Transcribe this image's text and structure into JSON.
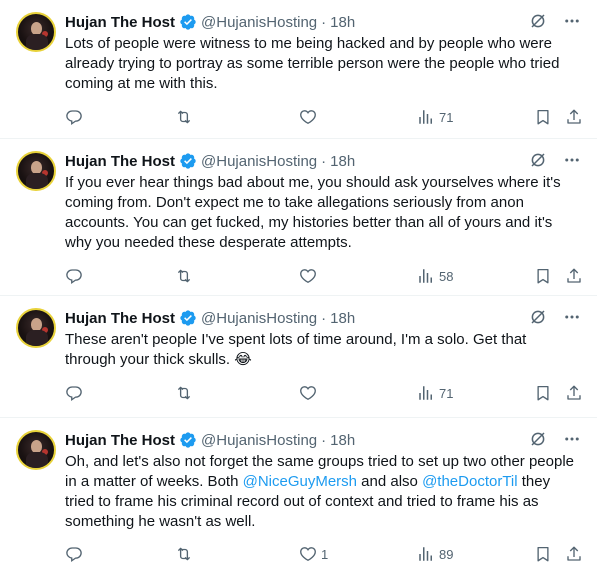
{
  "tweets": [
    {
      "name": "Hujan The Host",
      "handle": "@HujanisHosting",
      "sep": "·",
      "time": "18h",
      "text": "Lots of people were witness to me being hacked and by people who were already trying to portray as some terrible person were the people who tried coming at me with this.",
      "likes": "",
      "views": "71"
    },
    {
      "name": "Hujan The Host",
      "handle": "@HujanisHosting",
      "sep": "·",
      "time": "18h",
      "text": "If you ever hear things bad about me, you should ask yourselves where it's coming from. Don't expect me to take allegations seriously from anon accounts. You can get fucked, my histories better than all of yours and it's why you needed these desperate attempts.",
      "likes": "",
      "views": "58"
    },
    {
      "name": "Hujan The Host",
      "handle": "@HujanisHosting",
      "sep": "·",
      "time": "18h",
      "text": "These aren't people I've spent lots of time around, I'm a solo. Get that through your thick skulls. 😂",
      "likes": "",
      "views": "71"
    },
    {
      "name": "Hujan The Host",
      "handle": "@HujanisHosting",
      "sep": "·",
      "time": "18h",
      "text_a": "Oh, and let's also not forget the same groups tried to set up two other people in a matter of weeks. Both ",
      "mention1": "@NiceGuyMersh",
      "text_b": " and also ",
      "mention2": "@theDoctorTil",
      "text_c": " they tried to frame his criminal record out of context and tried to frame his as something he wasn't as well.",
      "likes": "1",
      "views": "89"
    }
  ],
  "colors": {
    "accent": "#1d9bf0",
    "muted": "#536471",
    "text": "#0f1419",
    "divider": "#eff3f4"
  },
  "icons": [
    "verified-badge-icon",
    "grok-icon",
    "more-icon",
    "reply-icon",
    "retweet-icon",
    "like-icon",
    "views-icon",
    "bookmark-icon",
    "share-icon"
  ]
}
